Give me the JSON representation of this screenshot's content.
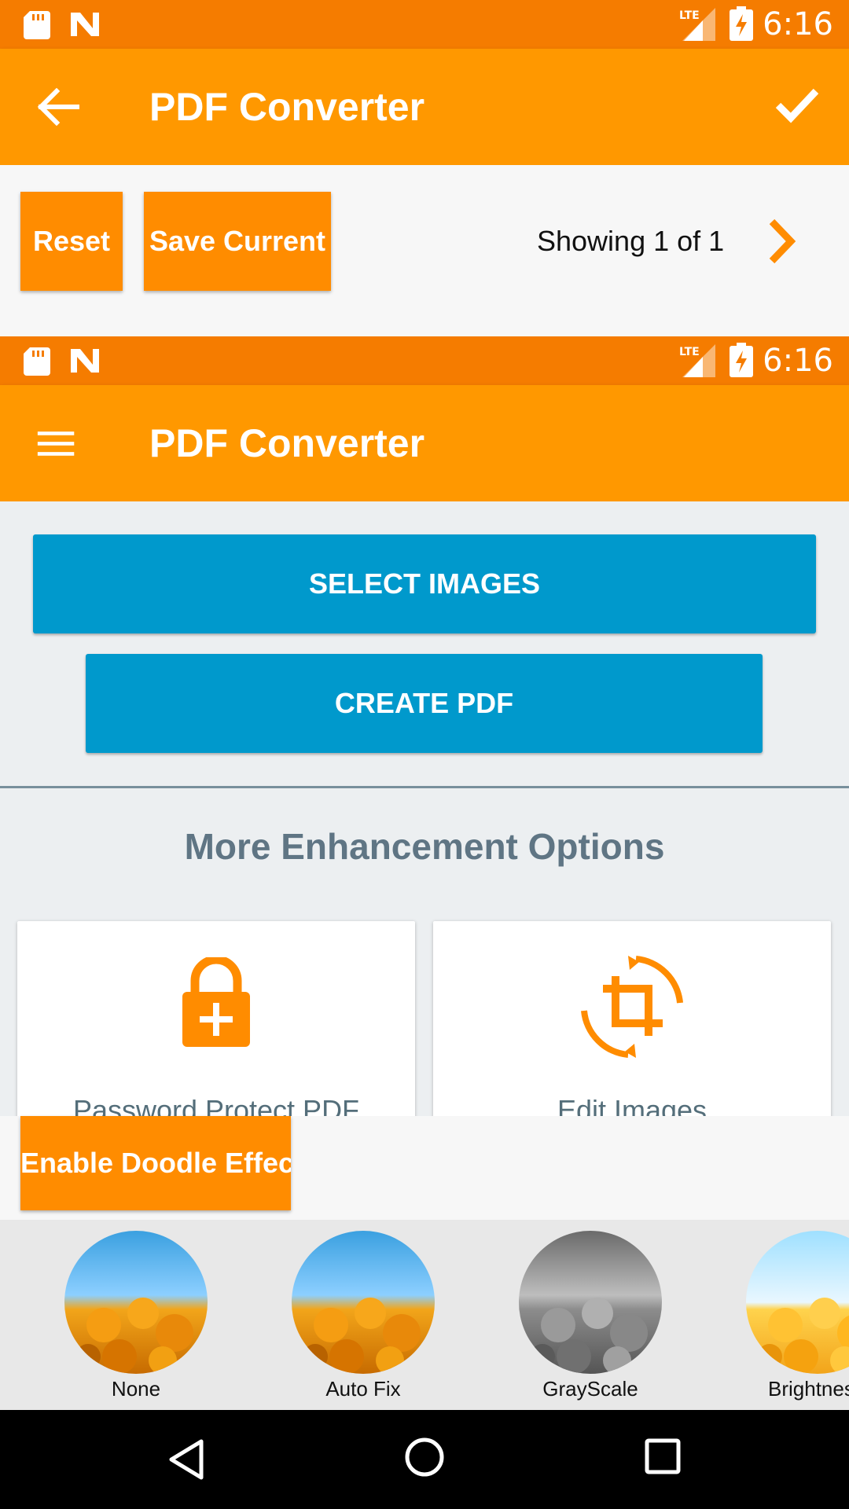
{
  "status_bar": {
    "time": "6:16",
    "network": "LTE"
  },
  "top_toolbar": {
    "title": "PDF Converter"
  },
  "editor_bar": {
    "reset_label": "Reset",
    "save_label": "Save Current",
    "page_info": "Showing 1 of 1"
  },
  "main_toolbar": {
    "title": "PDF Converter"
  },
  "actions": {
    "select_images": "SELECT IMAGES",
    "create_pdf": "CREATE PDF"
  },
  "enhancement": {
    "heading": "More Enhancement Options",
    "cards": [
      {
        "label": "Password Protect PDF",
        "icon": "lock-plus-icon"
      },
      {
        "label": "Edit Images",
        "icon": "crop-rotate-icon"
      }
    ]
  },
  "doodle": {
    "label": "Enable Doodle Effect"
  },
  "filters": [
    {
      "label": "None"
    },
    {
      "label": "Auto Fix"
    },
    {
      "label": "GrayScale"
    },
    {
      "label": "Brightness"
    }
  ],
  "colors": {
    "status": "#f57c00",
    "appbar": "#ff9800",
    "button_orange": "#ff8c00",
    "button_blue": "#0099cc",
    "heading": "#5f7584"
  }
}
